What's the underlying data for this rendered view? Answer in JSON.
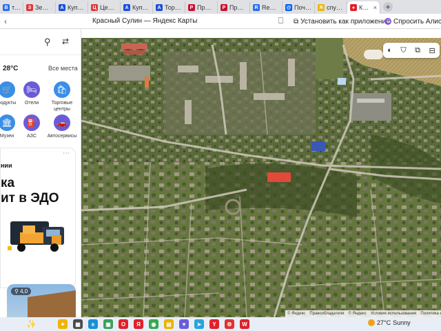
{
  "tabs": [
    {
      "label": "т банкр",
      "color": "#2a6ee8",
      "glyph": "B"
    },
    {
      "label": "Земель",
      "color": "#d93b3b",
      "glyph": "З"
    },
    {
      "label": "Купить",
      "color": "#1e4fd8",
      "glyph": "A"
    },
    {
      "label": "Центр д",
      "color": "#d93b3b",
      "glyph": "Ц"
    },
    {
      "label": "Купить",
      "color": "#1e4fd8",
      "glyph": "A"
    },
    {
      "label": "Торги п",
      "color": "#1e4fd8",
      "glyph": "A"
    },
    {
      "label": "Протоко",
      "color": "#c8102e",
      "glyph": "P"
    },
    {
      "label": "Протоко",
      "color": "#c8102e",
      "glyph": "P"
    },
    {
      "label": "Reuters",
      "color": "#2a6ee8",
      "glyph": "R"
    },
    {
      "label": "Почта М",
      "color": "#005ff9",
      "glyph": "@"
    },
    {
      "label": "спутник",
      "color": "#f0b400",
      "glyph": "Я"
    }
  ],
  "active_tab": {
    "label": "Крас",
    "close": "×"
  },
  "newtab": "+",
  "titlebar": {
    "title": "Красный Сулин — Яндекс Карты",
    "install": "Установить как приложение",
    "alice": "Спросить Алису А"
  },
  "sidebar": {
    "weather": "28°C",
    "all_places": "Все места",
    "categories": [
      {
        "label": "родукты",
        "color": "#3a8ee6",
        "glyph": "🛒"
      },
      {
        "label": "Отели",
        "color": "#6a5cd8",
        "glyph": "🛏"
      },
      {
        "label": "Торговые центры",
        "color": "#3a8ee6",
        "glyph": "🛍"
      },
      {
        "label": "Музеи",
        "color": "#3a8ee6",
        "glyph": "🏛"
      },
      {
        "label": "АЗС",
        "color": "#6a5cd8",
        "glyph": "⛽"
      },
      {
        "label": "Автосервисы",
        "color": "#6a5cd8",
        "glyph": "🚗"
      }
    ],
    "ad": {
      "menu": "⋯",
      "small": "нии",
      "line1": "ка",
      "line2": "ит в ЭДО"
    },
    "card_rating": "⚲ 4,0"
  },
  "map": {
    "controls": [
      "◐",
      "⛉",
      "⧉",
      "⊟"
    ],
    "copyright": [
      "© Яндекс",
      "Правообладатели",
      "© Яндекс",
      "Условия использования",
      "Политика конфиде"
    ]
  },
  "taskbar": {
    "weather": "27°C",
    "condition": "Sunny",
    "apps": [
      {
        "glyph": "✦",
        "color": "#f0b400"
      },
      {
        "glyph": "▦",
        "color": "#4a4a4a"
      },
      {
        "glyph": "e",
        "color": "#1a8fd8"
      },
      {
        "glyph": "▣",
        "color": "#3aa05a"
      },
      {
        "glyph": "O",
        "color": "#e0202a"
      },
      {
        "glyph": "Я",
        "color": "#e0202a"
      },
      {
        "glyph": "◉",
        "color": "#36a853"
      },
      {
        "glyph": "▤",
        "color": "#e9b200"
      },
      {
        "glyph": "♥",
        "color": "#6a5cd8"
      },
      {
        "glyph": "➤",
        "color": "#2aa3de"
      },
      {
        "glyph": "Y",
        "color": "#e0202a"
      },
      {
        "glyph": "⚙",
        "color": "#d33"
      },
      {
        "glyph": "W",
        "color": "#e0202a"
      }
    ]
  }
}
